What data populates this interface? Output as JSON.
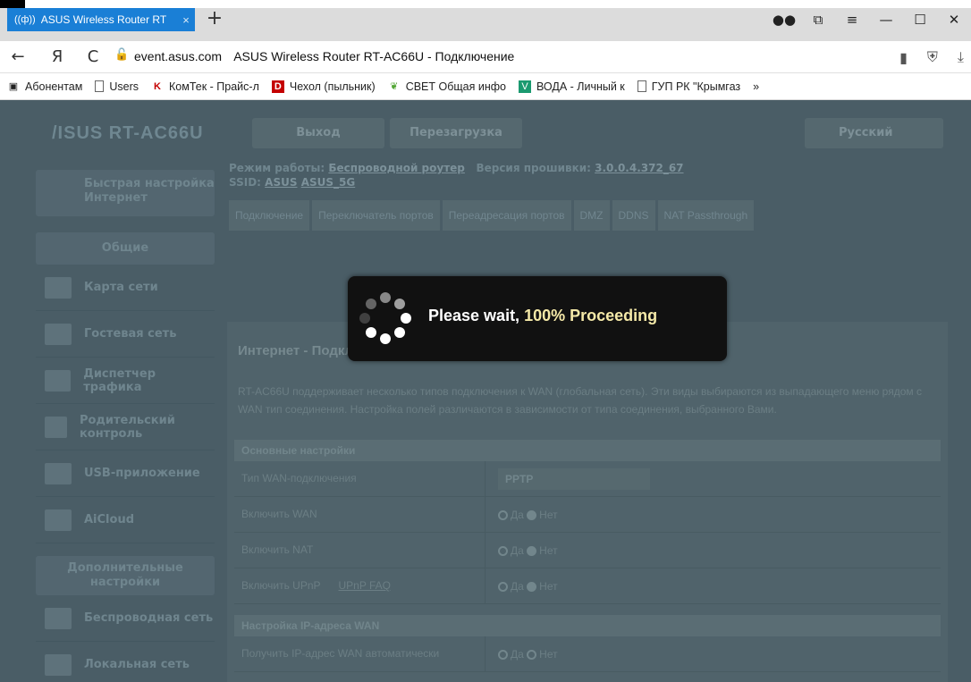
{
  "browser": {
    "tab_title": "ASUS Wireless Router RT",
    "tab_icon": "((ф))",
    "new_tab": "+",
    "url_domain": "event.asus.com",
    "url_title": "ASUS Wireless Router RT-AC66U - Подключение",
    "nav_back": "←",
    "nav_yandex": "Я",
    "nav_reload": "C",
    "bookmarks": [
      {
        "label": "Абонентам",
        "icon": "monitor-icon"
      },
      {
        "label": "Users",
        "icon": "page-icon"
      },
      {
        "label": "КомТек - Прайс-л",
        "icon": "komtek-icon"
      },
      {
        "label": "Чехол (пыльник)",
        "icon": "d-logo-icon"
      },
      {
        "label": "СВЕТ Общая инфо",
        "icon": "leaf-icon"
      },
      {
        "label": "ВОДА - Личный к",
        "icon": "voda-icon"
      },
      {
        "label": "ГУП РК \"Крымгаз",
        "icon": "page-icon"
      }
    ],
    "bookmarks_more": "»"
  },
  "router": {
    "logo": "/ISUS  RT-AC66U",
    "logout": "Выход",
    "reboot": "Перезагрузка",
    "language": "Русский",
    "status_mode_label": "Режим работы:",
    "status_mode_value": "Беспроводной роутер",
    "status_fw_label": "Версия прошивки:",
    "status_fw_value": "3.0.0.4.372_67",
    "status_ssid_label": "SSID:",
    "status_ssid_1": "ASUS",
    "status_ssid_2": "ASUS_5G",
    "quick_setup": "Быстрая настройка Интернет",
    "general_header": "Общие",
    "sidebar_items": [
      "Карта сети",
      "Гостевая сеть",
      "Диспетчер трафика",
      "Родительский контроль",
      "USB-приложение",
      "AiCloud"
    ],
    "advanced_header": "Дополнительные настройки",
    "advanced_items": [
      "Беспроводная сеть",
      "Локальная сеть"
    ],
    "subtabs": [
      "Подключение",
      "Переключатель портов",
      "Переадресация портов",
      "DMZ",
      "DDNS",
      "NAT Passthrough"
    ],
    "content_title": "Интернет - Подключение",
    "content_desc": "RT-AC66U поддерживает несколько типов подключения к WAN (глобальная сеть). Эти виды выбираются из выпадающего меню рядом с WAN тип соединения. Настройка полей различаются в зависимости от типа соединения, выбранного Вами.",
    "section_basic": "Основные настройки",
    "row_wan_type": "Тип WAN-подключения",
    "wan_type_value": "PPTP",
    "row_enable_wan": "Включить WAN",
    "row_enable_nat": "Включить NAT",
    "row_enable_upnp": "Включить UPnP",
    "upnp_faq": "UPnP FAQ",
    "yes": "Да",
    "no": "Нет",
    "section_ip": "Настройка IP-адреса WAN",
    "row_auto_ip": "Получить IP-адрес WAN автоматически"
  },
  "overlay": {
    "msg_prefix": "Please wait, ",
    "msg_highlight": "100% Proceeding"
  }
}
